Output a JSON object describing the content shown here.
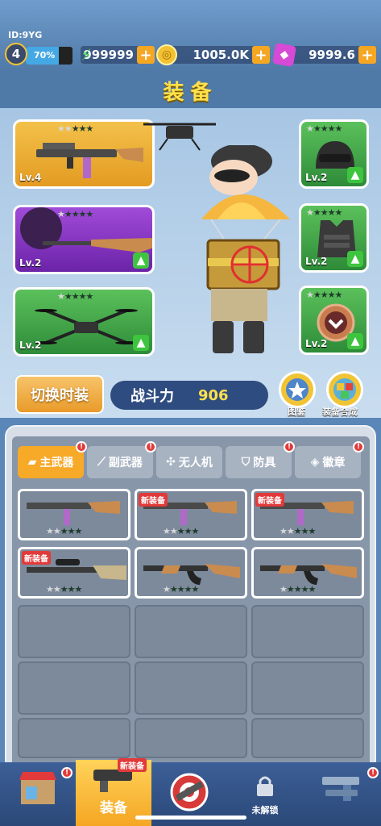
{
  "header": {
    "player_id": "ID:9YG",
    "level": "4",
    "xp_percent": "70%",
    "xp_fraction": 0.7,
    "energy": "999999",
    "coins": "1005.0K",
    "gems": "9999.6",
    "plus_symbol": "+"
  },
  "title": "装备",
  "equipped_slots": [
    {
      "slot": "main-weapon",
      "level": "Lv.4",
      "stars_filled": 2,
      "stars_total": 5,
      "rarity": "gold",
      "upgrade": false
    },
    {
      "slot": "secondary-weapon",
      "level": "Lv.2",
      "stars_filled": 1,
      "stars_total": 5,
      "rarity": "purple",
      "upgrade": true
    },
    {
      "slot": "drone",
      "level": "Lv.2",
      "stars_filled": 1,
      "stars_total": 5,
      "rarity": "green",
      "upgrade": true
    },
    {
      "slot": "helmet",
      "level": "Lv.2",
      "stars_filled": 1,
      "stars_total": 5,
      "rarity": "green",
      "upgrade": true
    },
    {
      "slot": "armor",
      "level": "Lv.2",
      "stars_filled": 1,
      "stars_total": 5,
      "rarity": "green",
      "upgrade": true
    },
    {
      "slot": "badge",
      "level": "Lv.2",
      "stars_filled": 1,
      "stars_total": 5,
      "rarity": "green",
      "upgrade": true
    }
  ],
  "actions": {
    "switch_outfit": "切换时装",
    "power_label": "战斗力",
    "power_value": "906",
    "codex": "图鉴",
    "synthesis": "装备合成"
  },
  "tabs": [
    {
      "label": "主武器",
      "active": true,
      "alert": "!"
    },
    {
      "label": "副武器",
      "active": false,
      "alert": "!"
    },
    {
      "label": "无人机",
      "active": false,
      "alert": ""
    },
    {
      "label": "防具",
      "active": false,
      "alert": "!"
    },
    {
      "label": "徽章",
      "active": false,
      "alert": "!"
    }
  ],
  "inventory": [
    {
      "rarity": "purple",
      "stars_filled": 2,
      "new_tag": "",
      "weapon": "smg"
    },
    {
      "rarity": "blue",
      "stars_filled": 2,
      "new_tag": "新装备",
      "weapon": "smg"
    },
    {
      "rarity": "blue",
      "stars_filled": 2,
      "new_tag": "新装备",
      "weapon": "smg"
    },
    {
      "rarity": "green",
      "stars_filled": 2,
      "new_tag": "新装备",
      "weapon": "sniper"
    },
    {
      "rarity": "purple",
      "stars_filled": 1,
      "new_tag": "",
      "weapon": "ak"
    },
    {
      "rarity": "green",
      "stars_filled": 1,
      "new_tag": "",
      "weapon": "ak"
    }
  ],
  "bottom_nav": [
    {
      "label": "",
      "icon": "shop-icon",
      "alert": "!"
    },
    {
      "label": "装备",
      "icon": "equipment-icon",
      "alert": "",
      "tag": "新装备",
      "active": true
    },
    {
      "label": "",
      "icon": "battle-icon",
      "alert": ""
    },
    {
      "label": "未解锁",
      "icon": "lock-icon",
      "alert": ""
    },
    {
      "label": "",
      "icon": "weapons-icon",
      "alert": "!"
    }
  ]
}
